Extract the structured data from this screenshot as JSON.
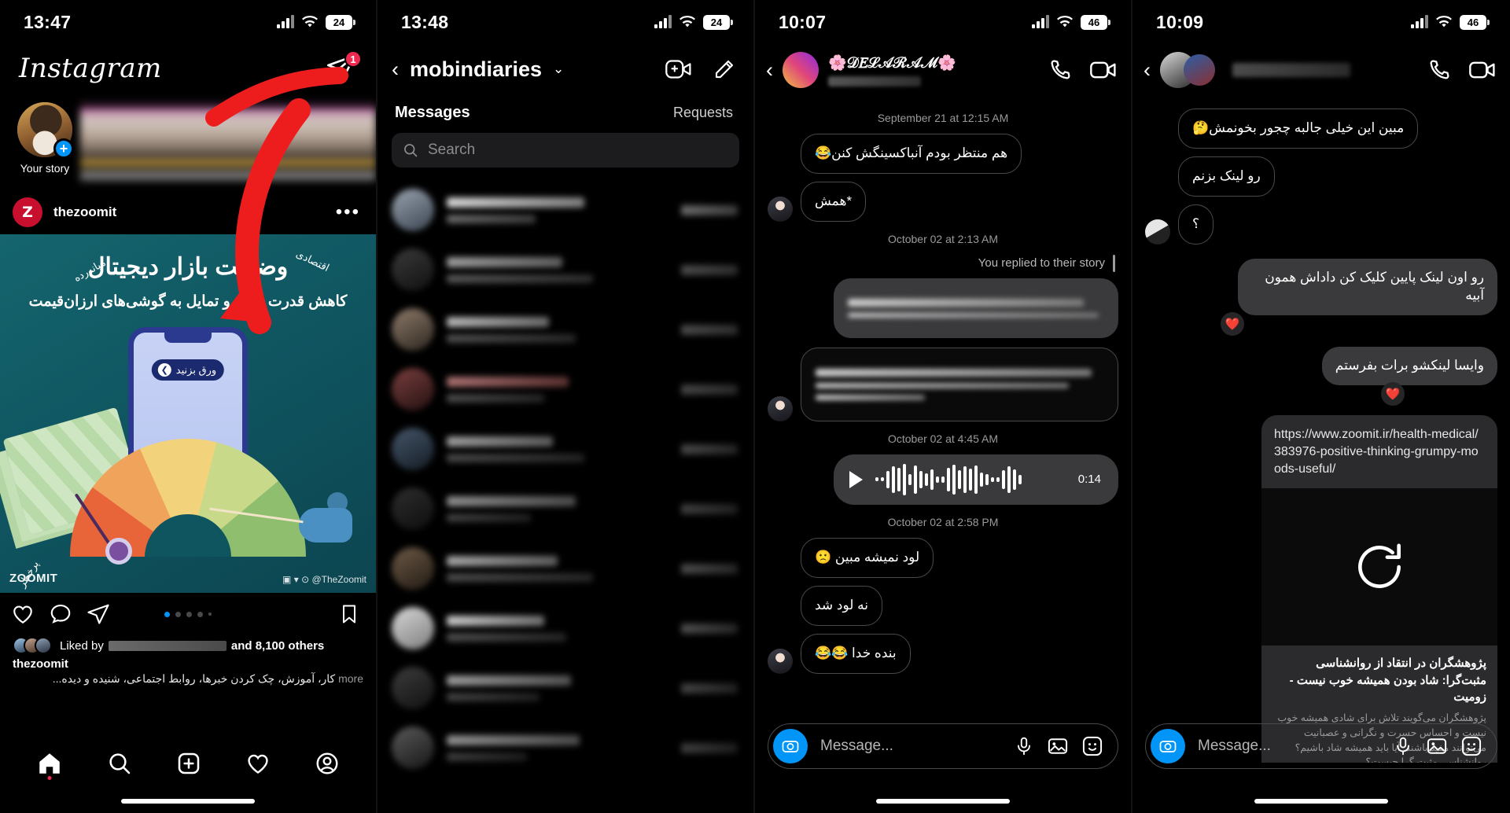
{
  "panels": [
    {
      "name": "instagram-feed",
      "status": {
        "time": "13:47",
        "battery": "24"
      },
      "app": {
        "logo": "Instagram"
      },
      "dm_badge": "1",
      "story": {
        "label": "Your story",
        "plus": "+"
      },
      "post": {
        "avatar_initials": "Z",
        "username": "thezoomit",
        "more_dots": "•••",
        "image": {
          "title": "وضعیت بازار دیجیتال",
          "subtitle": "کاهش قدرت خرید و تمایل به گوشی‌های ارزان‌قیمت",
          "swipe_label": "ورق بزنید",
          "gauge_labels": [
            "پرخطر",
            "میانه‌رده",
            "اقتصادی"
          ],
          "watermark": "ZOOMIT",
          "watermark_social": "▣ ▾ ⊙ @TheZoomit"
        },
        "carousel_dots": 5,
        "carousel_active": 0,
        "liked_by_prefix": "Liked by",
        "liked_by_suffix": "and 8,100 others",
        "liked_count": "8,100 others",
        "caption_user": "thezoomit",
        "caption_text": "کار، آموزش، چک کردن خبرها، روابط اجتماعی، شنیده و دیده...",
        "caption_more": "more"
      },
      "tabs": [
        "home-icon",
        "search-icon",
        "add-post-icon",
        "activity-heart-icon",
        "profile-icon"
      ]
    },
    {
      "name": "direct-messages-list",
      "status": {
        "time": "13:48",
        "battery": "24"
      },
      "header": {
        "title": "mobindiaries",
        "chevron": "⌄"
      },
      "tabs": {
        "messages": "Messages",
        "requests": "Requests"
      },
      "search": {
        "placeholder": "Search"
      },
      "rows": 10
    },
    {
      "name": "chat-delaram",
      "status": {
        "time": "10:07",
        "battery": "46"
      },
      "header": {
        "name": "🌸𝒟𝐸ℒ𝒜ℛ𝒜ℳ🌸"
      },
      "timestamps": [
        "September 21 at 12:15 AM",
        "October 02 at 2:13 AM",
        "October 02 at 4:45 AM",
        "October 02 at 2:58 PM"
      ],
      "messages": [
        {
          "side": "in",
          "text": "هم منتظر بودم آنباکسینگش کنن😂"
        },
        {
          "side": "in",
          "text": "*همش",
          "avatar": true
        },
        {
          "side": "out",
          "text": "",
          "blurred": true
        },
        {
          "side": "in",
          "text": "",
          "blurred": true,
          "avatar": true
        },
        {
          "side": "out",
          "voice": true,
          "duration": "0:14"
        },
        {
          "side": "in",
          "text": "لود نمیشه مبین 🙁"
        },
        {
          "side": "in",
          "text": "نه لود شد"
        },
        {
          "side": "in",
          "text": "بنده خدا 😂😂",
          "avatar": true
        }
      ],
      "story_reply_note": "You replied to their story",
      "composer": {
        "placeholder": "Message..."
      }
    },
    {
      "name": "chat-group-link",
      "status": {
        "time": "10:09",
        "battery": "46"
      },
      "messages": [
        {
          "side": "in",
          "text": "مبین این خیلی جالبه چجور بخونمش🤔"
        },
        {
          "side": "in",
          "text": "رو لینک بزنم"
        },
        {
          "side": "in",
          "text": "؟",
          "avatar": true
        },
        {
          "side": "out",
          "text": "رو اون لینک پایین کلیک کن داداش همون آبیه",
          "reaction": "❤️"
        },
        {
          "side": "out",
          "text": "وایسا لینکشو برات بفرستم",
          "reaction": "❤️"
        }
      ],
      "link_card": {
        "url": "https://www.zoomit.ir/health-medical/383976-positive-thinking-grumpy-moods-useful/",
        "title": "پژوهشگران در انتقاد از روانشناسی مثبت‌گرا: شاد بودن همیشه خوب نیست - زومیت",
        "description": "پژوهشگران می‌گویند تلاش برای شادی همیشه خوب نیست و احساس حسرت و نگرانی و عصبانیت می‌توانند مفید باشند. آیا باید همیشه شاد باشیم؟ روانشناسی مثبت گرا چیست؟",
        "reload_icon": "refresh-icon"
      },
      "composer": {
        "placeholder": "Message..."
      }
    }
  ],
  "colors": {
    "accent_blue": "#0095f6",
    "badge_red": "#ef2950",
    "arrow_red": "#ee1d1d",
    "bubble_out": "#3a3a3c",
    "teal_bg": "#0f5560"
  }
}
